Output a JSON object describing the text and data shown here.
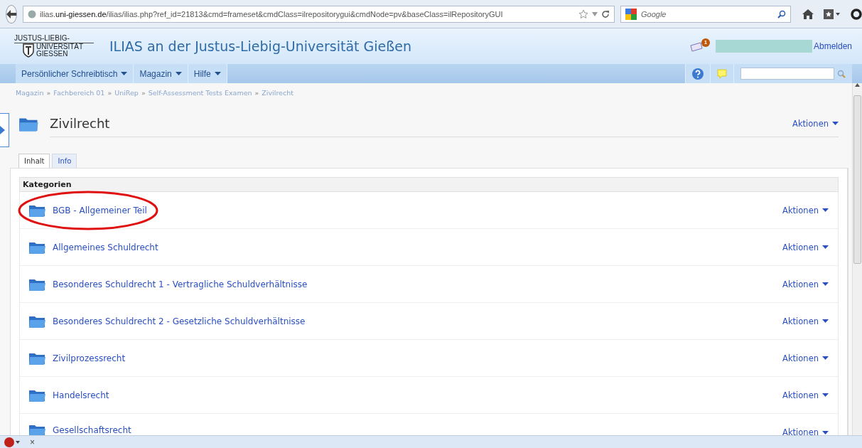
{
  "browser": {
    "url": "ilias.**uni-giessen.de**/ilias/ilias.php?ref_id=21813&cmd=frameset&cmdClass=ilrepositorygui&cmdNode=pv&baseClass=ilRepositoryGUI",
    "search_placeholder": "Google"
  },
  "header": {
    "logo_lines": [
      "JUSTUS-LIEBIG-",
      "UNIVERSITÄT",
      "GIESSEN"
    ],
    "title": "ILIAS an der Justus-Liebig-Universität Gießen",
    "mail_badge": "1",
    "logout": "Abmelden"
  },
  "nav": {
    "menus": [
      "Persönlicher Schreibtisch",
      "Magazin",
      "Hilfe"
    ]
  },
  "breadcrumb_separator": "»",
  "breadcrumbs": [
    "Magazin",
    "Fachbereich 01",
    "UniRep",
    "Self-Assessment Tests Examen",
    "Zivilrecht"
  ],
  "page": {
    "title": "Zivilrecht",
    "actions": "Aktionen"
  },
  "tabs": [
    {
      "label": "Inhalt",
      "selected": true
    },
    {
      "label": "Info",
      "selected": false
    }
  ],
  "section": {
    "title": "Kategorien",
    "items": [
      {
        "label": "BGB - Allgemeiner Teil",
        "actions": "Aktionen",
        "circled": true
      },
      {
        "label": "Allgemeines Schuldrecht",
        "actions": "Aktionen",
        "circled": false
      },
      {
        "label": "Besonderes Schuldrecht 1 - Vertragliche Schuldverhältnisse",
        "actions": "Aktionen",
        "circled": false
      },
      {
        "label": "Besonderes Schuldrecht 2 - Gesetzliche Schuldverhältnisse",
        "actions": "Aktionen",
        "circled": false
      },
      {
        "label": "Zivilprozessrecht",
        "actions": "Aktionen",
        "circled": false
      },
      {
        "label": "Handelsrecht",
        "actions": "Aktionen",
        "circled": false
      },
      {
        "label": "Gesellschaftsrecht",
        "actions": "Aktionen",
        "circled": false
      }
    ]
  },
  "addon_bar": {
    "close": "×"
  }
}
